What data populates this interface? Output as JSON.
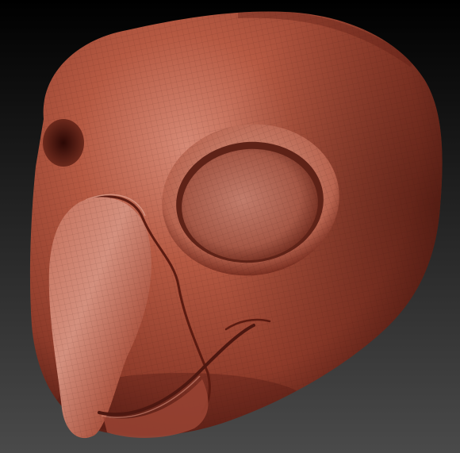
{
  "scene": {
    "subject": "sculpted-bird-head",
    "background_top": "#000000",
    "background_bottom": "#4a4a4a",
    "clay_highlight": "#d68a76",
    "clay_mid": "#b65a43",
    "clay_base": "#8e3b2a",
    "clay_shadow": "#4c1710",
    "wireframe_color": "#3a120c"
  }
}
